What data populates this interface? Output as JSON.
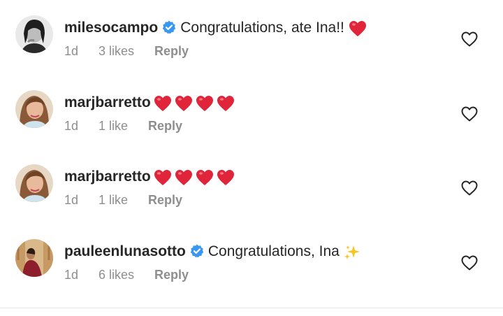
{
  "comments": [
    {
      "username": "milesocampo",
      "verified": true,
      "text": "Congratulations, ate Ina!!",
      "emoji": [
        "red-heart"
      ],
      "time": "1d",
      "likes": "3 likes",
      "reply_label": "Reply"
    },
    {
      "username": "marjbarretto",
      "verified": false,
      "text": "",
      "emoji": [
        "red-heart",
        "red-heart",
        "red-heart",
        "red-heart"
      ],
      "time": "1d",
      "likes": "1 like",
      "reply_label": "Reply"
    },
    {
      "username": "marjbarretto",
      "verified": false,
      "text": "",
      "emoji": [
        "red-heart",
        "red-heart",
        "red-heart",
        "red-heart"
      ],
      "time": "1d",
      "likes": "1 like",
      "reply_label": "Reply"
    },
    {
      "username": "pauleenlunasotto",
      "verified": true,
      "text": "Congratulations, Ina",
      "emoji": [
        "sparkles"
      ],
      "time": "1d",
      "likes": "6 likes",
      "reply_label": "Reply"
    }
  ],
  "colors": {
    "text": "#262626",
    "secondary": "#8e8e8e",
    "verified_blue": "#3897f0",
    "heart_red": "#e0243a",
    "sparkle_yellow": "#f7c51e"
  }
}
